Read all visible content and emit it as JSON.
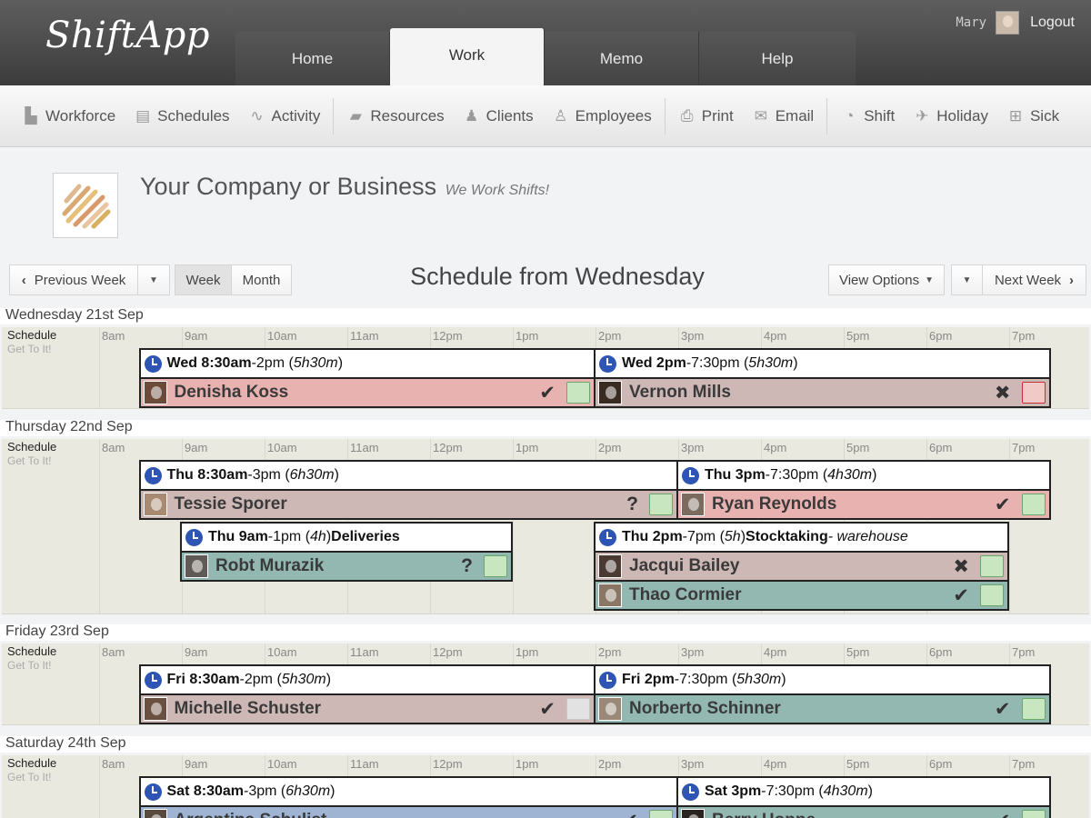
{
  "header": {
    "logo": "ShiftApp",
    "tabs": [
      {
        "label": "Home"
      },
      {
        "label": "Work"
      },
      {
        "label": "Memo"
      },
      {
        "label": "Help"
      }
    ],
    "user": {
      "name": "Mary",
      "logout": "Logout"
    }
  },
  "toolbar": {
    "items": [
      {
        "label": "Workforce",
        "icon": "factory-icon"
      },
      {
        "label": "Schedules",
        "icon": "clipboard-icon"
      },
      {
        "label": "Activity",
        "icon": "pulse-icon"
      },
      {
        "label": "Resources",
        "icon": "truck-icon"
      },
      {
        "label": "Clients",
        "icon": "client-icon"
      },
      {
        "label": "Employees",
        "icon": "user-icon"
      },
      {
        "label": "Print",
        "icon": "printer-icon"
      },
      {
        "label": "Email",
        "icon": "envelope-icon"
      },
      {
        "label": "Shift",
        "icon": "clock-icon"
      },
      {
        "label": "Holiday",
        "icon": "plane-icon"
      },
      {
        "label": "Sick",
        "icon": "medical-kit-icon"
      }
    ]
  },
  "company": {
    "name": "Your Company or Business",
    "tagline": "We Work Shifts!"
  },
  "nav": {
    "prev": "Previous Week",
    "week": "Week",
    "month": "Month",
    "title": "Schedule from Wednesday",
    "view_options": "View Options",
    "next": "Next Week"
  },
  "grid": {
    "label": "Schedule",
    "sublabel": "Get To It!",
    "hours": [
      "8am",
      "9am",
      "10am",
      "11am",
      "12pm",
      "1pm",
      "2pm",
      "3pm",
      "4pm",
      "5pm",
      "6pm",
      "7pm"
    ]
  },
  "days": [
    {
      "title": "Wednesday 21st Sep",
      "shifts": [
        {
          "start": 8.5,
          "end": 14,
          "row": 0,
          "when": "Wed 8:30am",
          "rest": "-2pm (",
          "dur": "5h30m",
          "close": ")",
          "task": "",
          "loc": "",
          "employees": [
            {
              "name": "Denisha Koss",
              "color": "red",
              "status": "✔",
              "box": "#c8e6c0",
              "avatar": "#6b4a3a"
            }
          ]
        },
        {
          "start": 14,
          "end": 19.5,
          "row": 0,
          "when": "Wed 2pm",
          "rest": "-7:30pm (",
          "dur": "5h30m",
          "close": ")",
          "task": "",
          "loc": "",
          "employees": [
            {
              "name": "Vernon Mills",
              "color": "mauve",
              "status": "✖",
              "box": "#f1c9c7",
              "avatar": "#3a2a22"
            }
          ]
        }
      ]
    },
    {
      "title": "Thursday 22nd Sep",
      "shifts": [
        {
          "start": 8.5,
          "end": 15,
          "row": 0,
          "when": "Thu 8:30am",
          "rest": "-3pm (",
          "dur": "6h30m",
          "close": ")",
          "task": "",
          "loc": "",
          "employees": [
            {
              "name": "Tessie Sporer",
              "color": "mauve",
              "status": "?",
              "box": "#c8e6c0",
              "avatar": "#a88a70"
            }
          ]
        },
        {
          "start": 15,
          "end": 19.5,
          "row": 0,
          "when": "Thu 3pm",
          "rest": "-7:30pm (",
          "dur": "4h30m",
          "close": ")",
          "task": "",
          "loc": "",
          "employees": [
            {
              "name": "Ryan Reynolds",
              "color": "red",
              "status": "✔",
              "box": "#c8e6c0",
              "avatar": "#7b6a5e"
            }
          ]
        },
        {
          "start": 9,
          "end": 13,
          "row": 1,
          "when": "Thu 9am",
          "rest": "-1pm (",
          "dur": "4h",
          "close": ") ",
          "task": "Deliveries",
          "loc": "",
          "employees": [
            {
              "name": "Robt Murazik",
              "color": "teal",
              "status": "?",
              "box": "#c8e6c0",
              "avatar": "#5f5a55"
            }
          ]
        },
        {
          "start": 14,
          "end": 19,
          "row": 1,
          "when": "Thu 2pm",
          "rest": "-7pm (",
          "dur": "5h",
          "close": ") ",
          "task": "Stocktaking",
          "loc": " - warehouse",
          "employees": [
            {
              "name": "Jacqui Bailey",
              "color": "mauve",
              "status": "✖",
              "box": "#c8e6c0",
              "avatar": "#4a3a33"
            },
            {
              "name": "Thao Cormier",
              "color": "teal",
              "status": "✔",
              "box": "#c8e6c0",
              "avatar": "#8a7664"
            }
          ]
        }
      ]
    },
    {
      "title": "Friday 23rd Sep",
      "shifts": [
        {
          "start": 8.5,
          "end": 14,
          "row": 0,
          "when": "Fri 8:30am",
          "rest": "-2pm (",
          "dur": "5h30m",
          "close": ")",
          "task": "",
          "loc": "",
          "employees": [
            {
              "name": "Michelle Schuster",
              "color": "mauve",
              "status": "✔",
              "box": "#e2e2e2",
              "avatar": "#6a5040"
            }
          ]
        },
        {
          "start": 14,
          "end": 19.5,
          "row": 0,
          "when": "Fri 2pm",
          "rest": "-7:30pm (",
          "dur": "5h30m",
          "close": ")",
          "task": "",
          "loc": "",
          "employees": [
            {
              "name": "Norberto Schinner",
              "color": "teal",
              "status": "✔",
              "box": "#c8e6c0",
              "avatar": "#9a8878"
            }
          ]
        }
      ]
    },
    {
      "title": "Saturday 24th Sep",
      "shifts": [
        {
          "start": 8.5,
          "end": 15,
          "row": 0,
          "when": "Sat 8:30am",
          "rest": "-3pm (",
          "dur": "6h30m",
          "close": ")",
          "task": "",
          "loc": "",
          "employees": [
            {
              "name": "Argentina Schulist",
              "color": "blue",
              "status": "✔",
              "box": "#c8e6c0",
              "avatar": "#5a4a3e"
            }
          ]
        },
        {
          "start": 15,
          "end": 19.5,
          "row": 0,
          "when": "Sat 3pm",
          "rest": "-7:30pm (",
          "dur": "4h30m",
          "close": ")",
          "task": "",
          "loc": "",
          "employees": [
            {
              "name": "Berry Hoppe",
              "color": "teal",
              "status": "✔",
              "box": "#c8e6c0",
              "avatar": "#2a2420"
            }
          ]
        }
      ]
    }
  ]
}
